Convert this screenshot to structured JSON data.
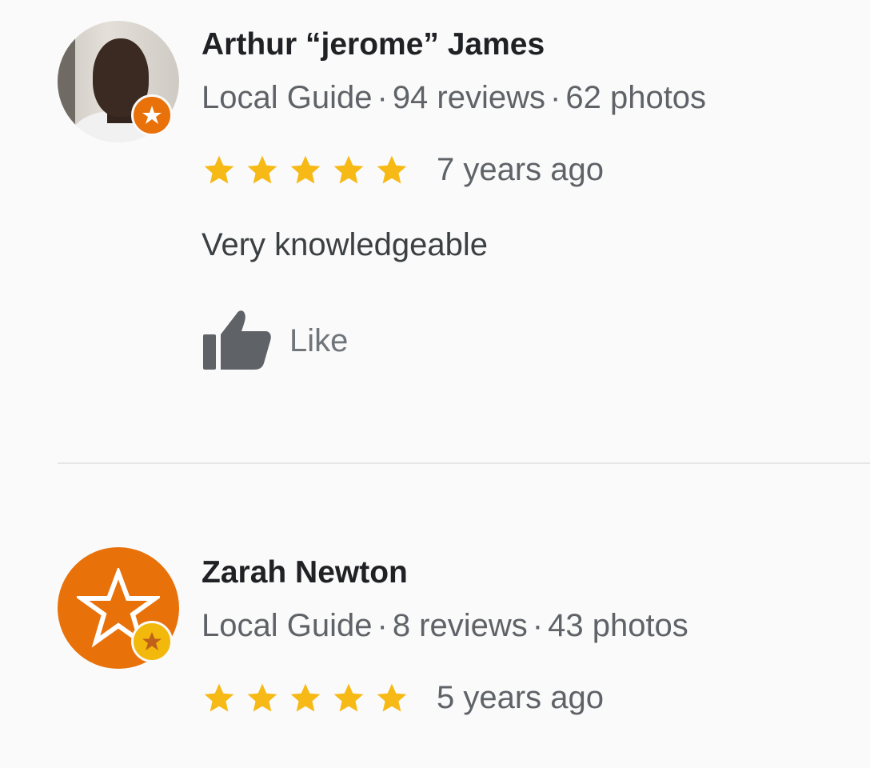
{
  "reviews": [
    {
      "name": "Arthur “jerome” James",
      "guide_label": "Local Guide",
      "separator": "·",
      "reviews_count": "94 reviews",
      "photos_count": "62 photos",
      "rating": 5,
      "time": "7 years ago",
      "text": "Very knowledgeable",
      "like_label": "Like",
      "avatar": "profile-photo",
      "badge_icon": "local-guide-badge-icon"
    },
    {
      "name": "Zarah Newton",
      "guide_label": "Local Guide",
      "separator": "·",
      "reviews_count": "8 reviews",
      "photos_count": "43 photos",
      "rating": 5,
      "time": "5 years ago",
      "avatar": "star-avatar-icon",
      "badge_icon": "local-guide-star-badge-icon"
    }
  ],
  "colors": {
    "star": "#f6b915",
    "accent_orange": "#e8710a",
    "badge_yellow": "#f2b90c",
    "text_primary": "#202124",
    "text_secondary": "#5f6368"
  }
}
